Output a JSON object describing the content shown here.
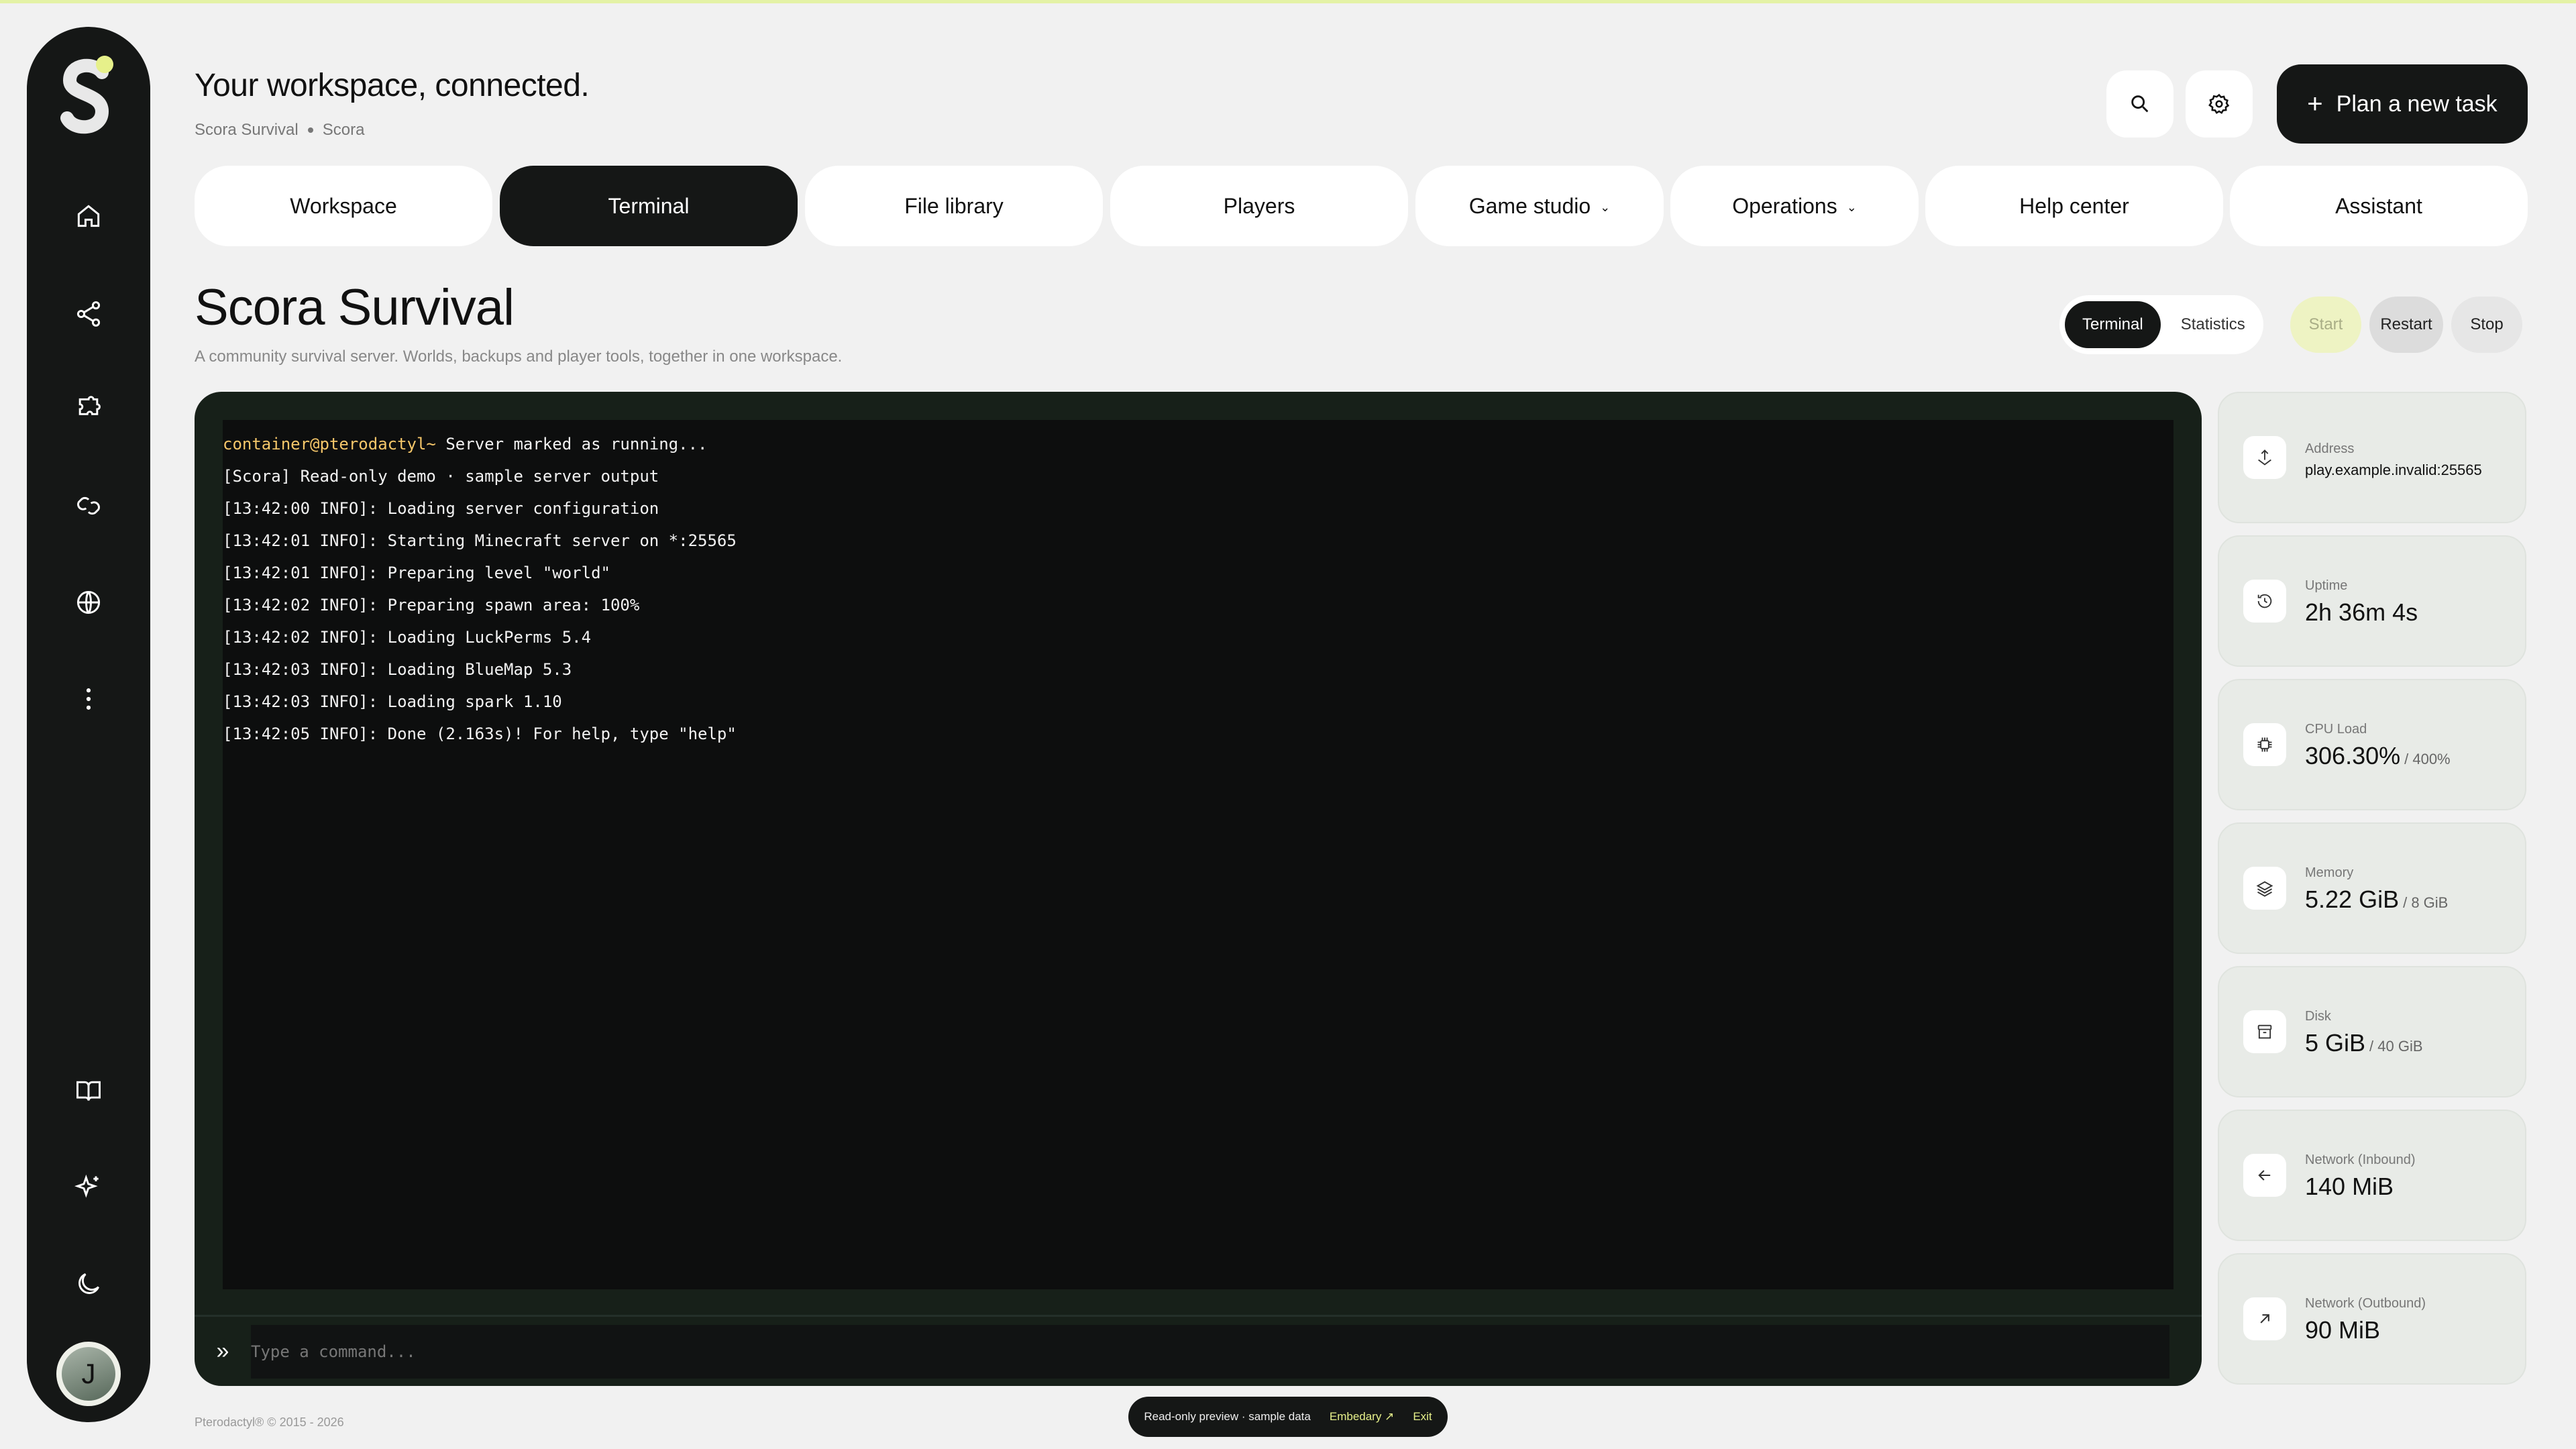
{
  "header": {
    "heading": "Your workspace, connected.",
    "breadcrumb": [
      "Scora Survival",
      "Scora"
    ],
    "plan_button": "Plan a new task"
  },
  "sidebar": {
    "items": [
      "home-icon",
      "share-icon",
      "puzzle-icon",
      "link-icon",
      "globe-icon",
      "more-icon"
    ],
    "bottom_items": [
      "book-icon",
      "sparkles-icon",
      "moon-icon"
    ],
    "avatar_initial": "J"
  },
  "nav": {
    "tabs": [
      {
        "label": "Workspace"
      },
      {
        "label": "Terminal",
        "active": true
      },
      {
        "label": "File library"
      },
      {
        "label": "Players"
      },
      {
        "label": "Game studio",
        "dropdown": true
      },
      {
        "label": "Operations",
        "dropdown": true
      },
      {
        "label": "Help center"
      },
      {
        "label": "Assistant"
      }
    ]
  },
  "server": {
    "title": "Scora Survival",
    "description": "A community survival server. Worlds, backups and player tools, together in one workspace.",
    "view_toggle": [
      "Terminal",
      "Statistics"
    ],
    "actions": {
      "start": "Start",
      "restart": "Restart",
      "stop": "Stop"
    }
  },
  "terminal": {
    "prompt_user": "container@pterodactyl~",
    "prompt_text": " Server marked as running...",
    "lines": [
      "[Scora] Read-only demo · sample server output",
      "[13:42:00 INFO]: Loading server configuration",
      "[13:42:01 INFO]: Starting Minecraft server on *:25565",
      "[13:42:01 INFO]: Preparing level \"world\"",
      "[13:42:02 INFO]: Preparing spawn area: 100%",
      "[13:42:02 INFO]: Loading LuckPerms 5.4",
      "[13:42:03 INFO]: Loading BlueMap 5.3",
      "[13:42:03 INFO]: Loading spark 1.10",
      "[13:42:05 INFO]: Done (2.163s)! For help, type \"help\""
    ],
    "input_placeholder": "Type a command..."
  },
  "stats": [
    {
      "label": "Address",
      "value": "play.example.invalid:25565",
      "max": "",
      "icon": "address-icon"
    },
    {
      "label": "Uptime",
      "value": "2h 36m 4s",
      "max": "",
      "icon": "clock-icon"
    },
    {
      "label": "CPU Load",
      "value": "306.30%",
      "max": "/ 400%",
      "icon": "cpu-icon"
    },
    {
      "label": "Memory",
      "value": "5.22 GiB",
      "max": "/ 8 GiB",
      "icon": "layers-icon"
    },
    {
      "label": "Disk",
      "value": "5 GiB",
      "max": "/ 40 GiB",
      "icon": "archive-icon"
    },
    {
      "label": "Network (Inbound)",
      "value": "140 MiB",
      "max": "",
      "icon": "arrow-left-icon"
    },
    {
      "label": "Network (Outbound)",
      "value": "90 MiB",
      "max": "",
      "icon": "arrow-up-right-icon"
    }
  ],
  "footer": {
    "copyright": "Pterodactyl® © 2015 - 2026",
    "preview_text": "Read-only preview · sample data",
    "preview_link": "Embedary ↗",
    "exit": "Exit"
  },
  "colors": {
    "accent": "#e6f08a",
    "start_button": "#eef3c3",
    "dark": "#151716",
    "terminal_bg": "#0d0e0e",
    "prompt": "#f5c76a"
  }
}
